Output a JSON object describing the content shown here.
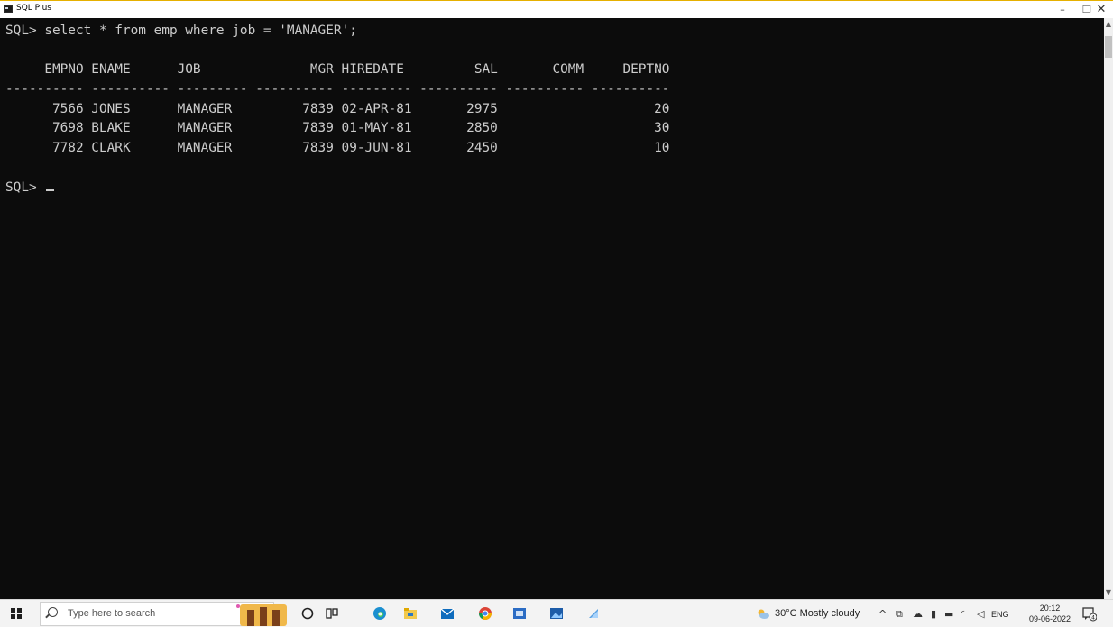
{
  "window": {
    "title": "SQL Plus",
    "min": "–",
    "max": "❐",
    "close": "✕"
  },
  "console": {
    "lines": [
      "SQL> select * from emp where job = 'MANAGER';",
      "",
      "     EMPNO ENAME      JOB              MGR HIREDATE         SAL       COMM     DEPTNO",
      "---------- ---------- --------- ---------- --------- ---------- ---------- ----------",
      "      7566 JONES      MANAGER         7839 02-APR-81       2975                    20",
      "      7698 BLAKE      MANAGER         7839 01-MAY-81       2850                    30",
      "      7782 CLARK      MANAGER         7839 09-JUN-81       2450                    10",
      "",
      "SQL> "
    ]
  },
  "taskbar": {
    "search_placeholder": "Type here to search",
    "weather": "30°C  Mostly cloudy",
    "lang": "ENG",
    "time": "20:12",
    "date": "09-06-2022",
    "notification_count": "4"
  },
  "colors": {
    "console_bg": "#0c0c0c",
    "console_fg": "#cccccc",
    "taskbar_bg": "#f3f3f3"
  }
}
